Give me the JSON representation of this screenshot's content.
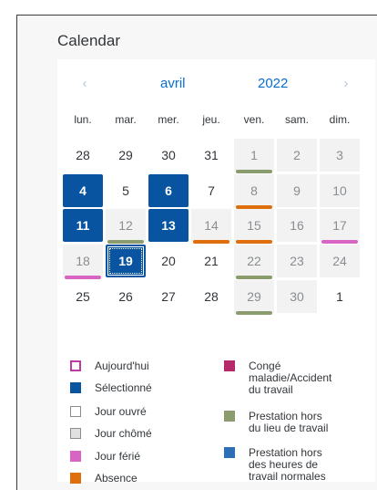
{
  "title": "Calendar",
  "header": {
    "month": "avril",
    "year": "2022",
    "prev_icon": "chevron-left-icon",
    "next_icon": "chevron-right-icon"
  },
  "weekdays": [
    "lun.",
    "mar.",
    "mer.",
    "jeu.",
    "ven.",
    "sam.",
    "dim."
  ],
  "colors": {
    "selected": "#0854a0",
    "nonwork_bg": "#f2f2f2",
    "work_bg": "#ffffff",
    "today": "#c0399f",
    "holiday": "#d864c4",
    "absence": "#df6e0c",
    "offsite": "#8a9c6e",
    "outside_hours": "#2e6eb5",
    "sick": "#b8286c"
  },
  "weeks": [
    [
      {
        "d": "28",
        "t": "work"
      },
      {
        "d": "29",
        "t": "work"
      },
      {
        "d": "30",
        "t": "work"
      },
      {
        "d": "31",
        "t": "work"
      },
      {
        "d": "1",
        "t": "off",
        "m": "offsite"
      },
      {
        "d": "2",
        "t": "off"
      },
      {
        "d": "3",
        "t": "off"
      }
    ],
    [
      {
        "d": "4",
        "t": "sel"
      },
      {
        "d": "5",
        "t": "work"
      },
      {
        "d": "6",
        "t": "sel"
      },
      {
        "d": "7",
        "t": "work"
      },
      {
        "d": "8",
        "t": "off",
        "m": "absence"
      },
      {
        "d": "9",
        "t": "off"
      },
      {
        "d": "10",
        "t": "off"
      }
    ],
    [
      {
        "d": "11",
        "t": "sel"
      },
      {
        "d": "12",
        "t": "off",
        "m": "offsite"
      },
      {
        "d": "13",
        "t": "sel"
      },
      {
        "d": "14",
        "t": "off",
        "m": "absence"
      },
      {
        "d": "15",
        "t": "off",
        "m": "absence"
      },
      {
        "d": "16",
        "t": "off"
      },
      {
        "d": "17",
        "t": "off",
        "m": "holiday"
      }
    ],
    [
      {
        "d": "18",
        "t": "off",
        "m": "holiday"
      },
      {
        "d": "19",
        "t": "today"
      },
      {
        "d": "20",
        "t": "work"
      },
      {
        "d": "21",
        "t": "work"
      },
      {
        "d": "22",
        "t": "off",
        "m": "offsite"
      },
      {
        "d": "23",
        "t": "off"
      },
      {
        "d": "24",
        "t": "off"
      }
    ],
    [
      {
        "d": "25",
        "t": "work"
      },
      {
        "d": "26",
        "t": "work"
      },
      {
        "d": "27",
        "t": "work"
      },
      {
        "d": "28",
        "t": "work"
      },
      {
        "d": "29",
        "t": "off",
        "m": "offsite"
      },
      {
        "d": "30",
        "t": "off"
      },
      {
        "d": "1",
        "t": "work"
      }
    ]
  ],
  "legend_left": [
    {
      "label": "Aujourd'hui",
      "type": "today"
    },
    {
      "label": "Sélectionné",
      "type": "selected"
    },
    {
      "label": "Jour ouvré",
      "type": "work"
    },
    {
      "label": "Jour chômé",
      "type": "nonwork"
    },
    {
      "label": "Jour férié",
      "type": "holiday"
    },
    {
      "label": "Absence",
      "type": "absence"
    }
  ],
  "legend_right": [
    {
      "lines": [
        "Congé",
        "maladie/Accident",
        "du travail"
      ],
      "type": "sick"
    },
    {
      "lines": [
        "Prestation hors",
        "du lieu de travail"
      ],
      "type": "offsite"
    },
    {
      "lines": [
        "Prestation hors",
        "des heures de",
        "travail normales"
      ],
      "type": "outside_hours"
    }
  ]
}
